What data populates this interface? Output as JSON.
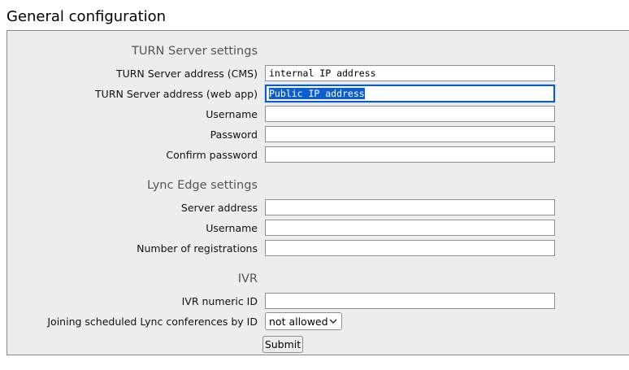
{
  "page": {
    "title": "General configuration"
  },
  "turn": {
    "heading": "TURN Server settings",
    "fields": [
      {
        "label": "TURN Server address (CMS)",
        "value": "internal IP address",
        "focused": false
      },
      {
        "label": "TURN Server address (web app)",
        "value": "Public IP address",
        "focused": true,
        "selected": true
      },
      {
        "label": "Username",
        "value": ""
      },
      {
        "label": "Password",
        "value": ""
      },
      {
        "label": "Confirm password",
        "value": ""
      }
    ]
  },
  "lync": {
    "heading": "Lync Edge settings",
    "fields": [
      {
        "label": "Server address",
        "value": ""
      },
      {
        "label": "Username",
        "value": ""
      },
      {
        "label": "Number of registrations",
        "value": ""
      }
    ]
  },
  "ivr": {
    "heading": "IVR",
    "fields": [
      {
        "label": "IVR numeric ID",
        "value": ""
      }
    ],
    "join_label": "Joining scheduled Lync conferences by ID",
    "join_select": {
      "selected": "not allowed",
      "icon": "chevron-down-icon"
    }
  },
  "form": {
    "submit_label": "Submit"
  }
}
